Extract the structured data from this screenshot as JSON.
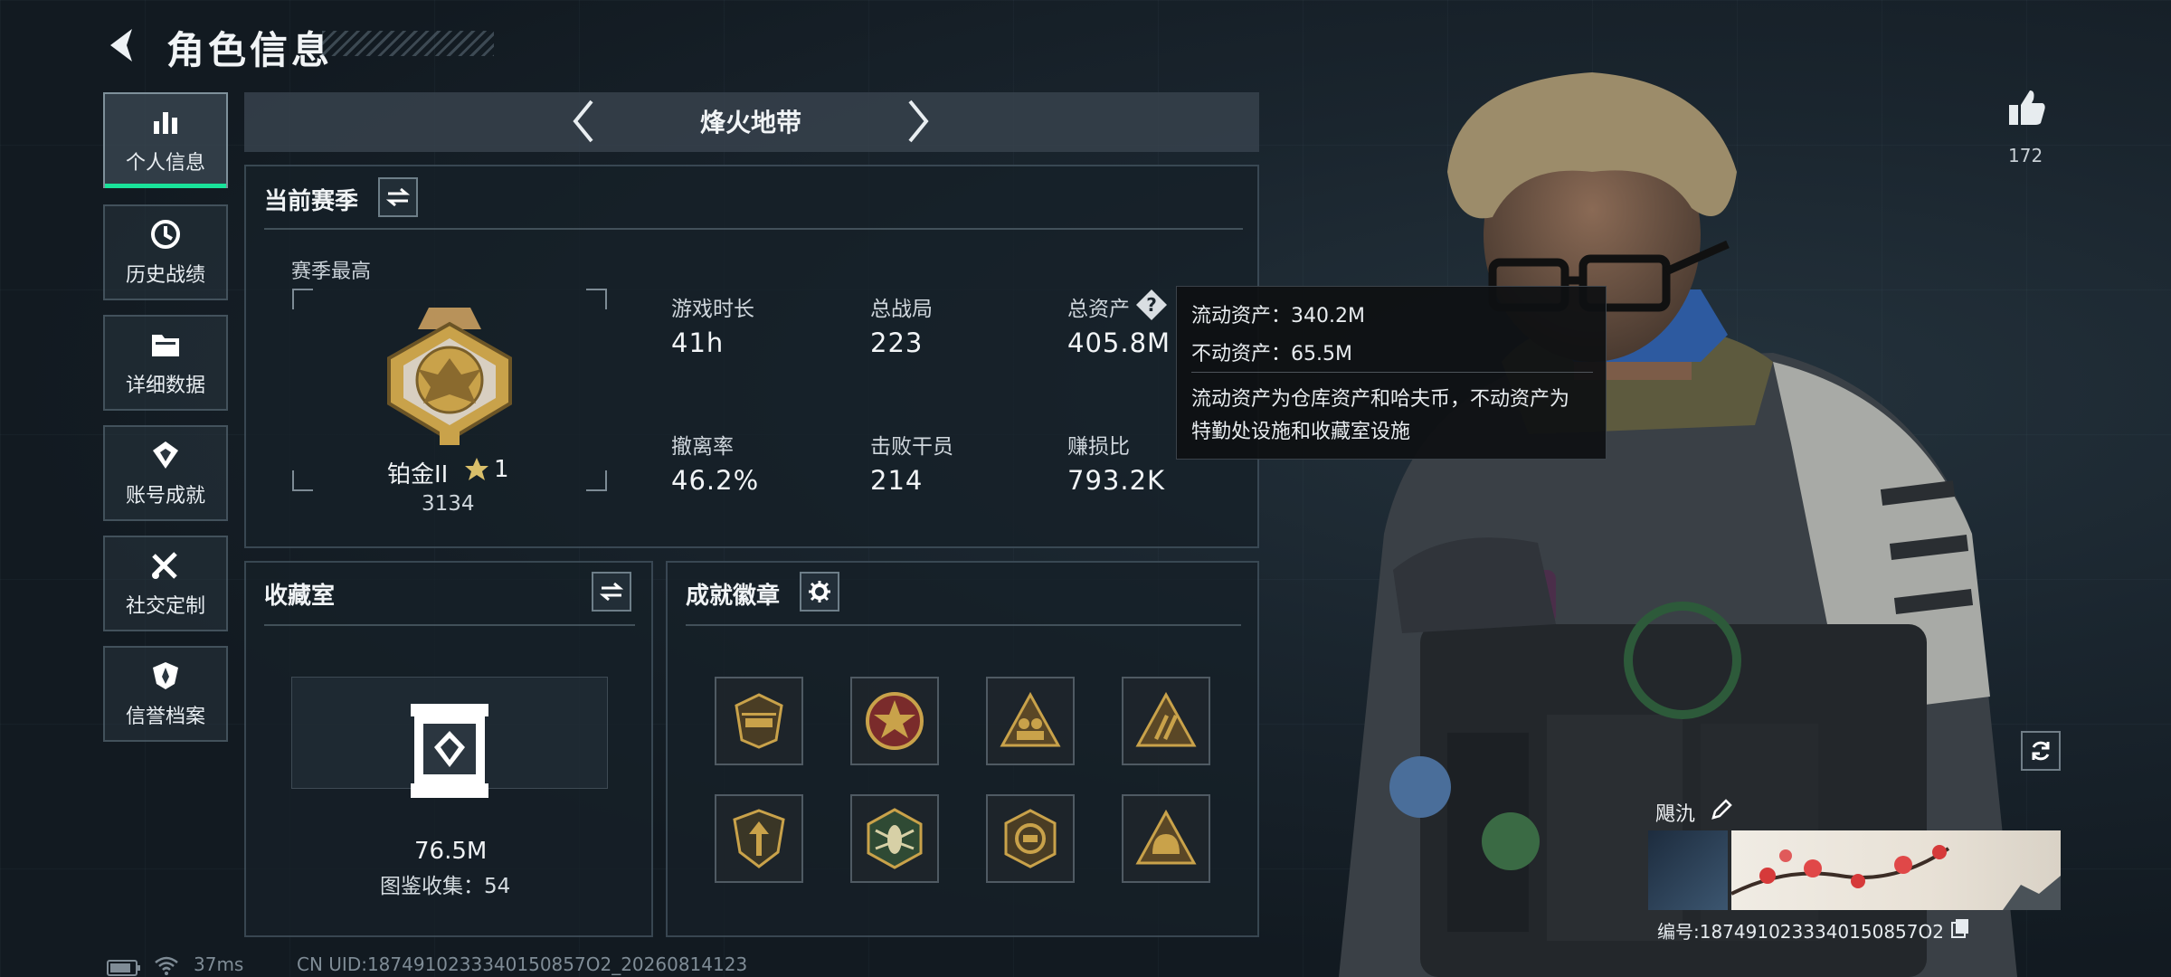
{
  "header": {
    "title": "角色信息"
  },
  "nav": {
    "items": [
      {
        "label": "个人信息",
        "icon": "bar-chart-icon",
        "active": true
      },
      {
        "label": "历史战绩",
        "icon": "clock-icon"
      },
      {
        "label": "详细数据",
        "icon": "folder-icon"
      },
      {
        "label": "账号成就",
        "icon": "achievement-icon"
      },
      {
        "label": "社交定制",
        "icon": "tools-icon"
      },
      {
        "label": "信誉档案",
        "icon": "shield-icon"
      }
    ]
  },
  "mode": {
    "label": "烽火地带"
  },
  "season": {
    "title": "当前赛季",
    "best_label": "赛季最高",
    "rank_name": "铂金II",
    "rank_stars": "1",
    "rank_score": "3134",
    "stats": [
      {
        "label": "游戏时长",
        "value": "41h"
      },
      {
        "label": "总战局",
        "value": "223"
      },
      {
        "label": "总资产",
        "value": "405.8M"
      },
      {
        "label": "撤离率",
        "value": "46.2%"
      },
      {
        "label": "击败干员",
        "value": "214"
      },
      {
        "label": "赚损比",
        "value": "793.2K"
      }
    ]
  },
  "tooltip": {
    "line1": "流动资产：340.2M",
    "line2": "不动资产：65.5M",
    "desc1": "流动资产为仓库资产和哈夫币，不动资产为",
    "desc2": "特勤处设施和收藏室设施"
  },
  "collection": {
    "title": "收藏室",
    "value": "76.5M",
    "catalog": "图鉴收集：54"
  },
  "achievements": {
    "title": "成就徽章"
  },
  "profile": {
    "likes": "172",
    "name": "飓氿",
    "id_text": "编号:1874910233340150857O2"
  },
  "status": {
    "ping": "37ms",
    "uid": "CN UID:1874910233340150857O2_20260814123"
  },
  "colors": {
    "accent": "#19e39a",
    "gold": "#c9a24a",
    "panel": "#16202a"
  }
}
